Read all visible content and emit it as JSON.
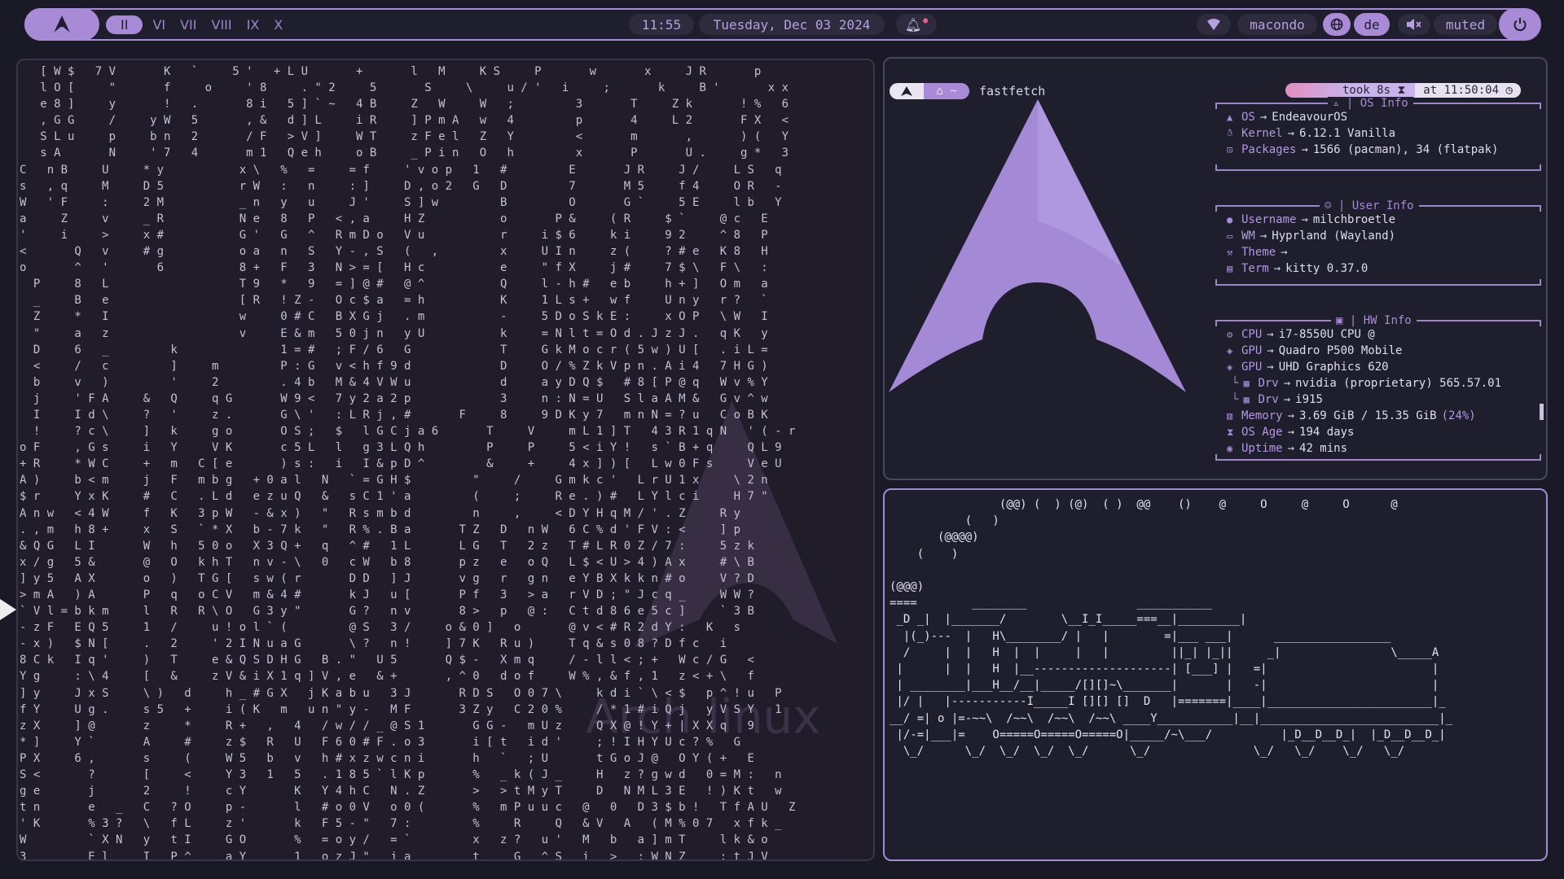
{
  "bar": {
    "workspaces": [
      {
        "label": "II",
        "active": true
      },
      {
        "label": "VI",
        "active": false
      },
      {
        "label": "VII",
        "active": false
      },
      {
        "label": "VIII",
        "active": false
      },
      {
        "label": "IX",
        "active": false
      },
      {
        "label": "X",
        "active": false
      }
    ],
    "time": "11:55",
    "date": "Tuesday, Dec 03 2024",
    "hostname": "macondo",
    "language": "de",
    "volume_status": "muted",
    "icons": [
      "arch-logo-icon",
      "bell-icon",
      "wifi-icon",
      "globe-icon",
      "speaker-muted-icon",
      "power-icon"
    ]
  },
  "matrix": {
    "watermark": "Arch linux",
    "lines": [
      "   [ W $   7 V       K   `     5 '   + L U       +       l   M     K S     P       w       x     J R       p",
      "   l O [     \"       f     o     ' 8     . \" 2     5       S     \\     u / '   i     ;       k     B '       x x",
      "   e 8 ]     y       !   .       8 i   5 ] ` ~   4 B     Z   W     W   ;         3       T     Z k       ! %   6",
      "   , G G     /     y W   5       , &   d ] L     i R     ] P m A   w   4         p       4     L 2       F X   <",
      "   S L u     p     b n   2       / F   > V ]     W T     z F e l   Z   Y         <       m       ,       ) (   Y",
      "   s A       N     ' 7   4       m 1   Q e h     o B     _ P i n   O   h         x       P       U .     g *   3",
      "C   n B     U     * y           x \\   %   =     = f     ' v o p   1   #         E       J R     J /     L S   q",
      "s   , q     M     D 5           r W   :   n     : ]     D , o 2   G   D         7       M 5     f 4     O R   -",
      "W   ' F     :     2 M           _ n   y   u     J '     S ] w         B         O       G `     5 E     l b   Y",
      "a     Z     v     _ R           N e   8   P   < , a     H Z           o       P &     ( R     $ `     @ c   E",
      "'     i     >     x #           G '   G   ^   R m D o   V u           r     i $ 6     k i     9 2     ^ 8   P",
      "<       Q   v     # g           o a   n   S   Y - , S   (   ,         x     U I n     z (     ? # e   K 8   H",
      "o       ^   '       6           8 +   F   3   N > = [   H c           e     \" f X     j #     7 $ \\   F \\   :",
      "  P     8   L                   T 9   *   9   = ] @ #   @ ^           Q     l - h #   e b     h + ]   O m   a",
      "  _     B   e                   [ R   ! Z -   O c $ a   = h           K     1 L s +   w f     U n y   r ?   `",
      "  Z     *   I                   w     0 # C   B X G j   . m           -     5 D o S k E :     x O P   \\ W   I",
      "  \"     a   z                   v     E & m   5 0 j n   y U           k     = N l t = O d . J z J .   q K   y",
      "  D     6   _         k               1 = #   ; F / 6   G             T     G k M o c r ( 5 w ) U [   . i L =",
      "  <     /   c         ]     m         P : G   v < h f 9 d             D     O / % Z k V p n . A i 4   7 H G )",
      "  b     v   )         '     2         . 4 b   M & 4 V W u             d     a y D Q $   # 8 [ P @ q   W v % Y",
      "  j     ' F A     &   Q     q G       W 9 <   7 y 2 a 2 p             3     n : N = U   S l a A M &   G v ^ w",
      "  I     I d \\     ?   '     z .       G \\ '   : L R j , #       F     8     9 D K y 7   m n N = ? u   C o B K",
      "  !     ? c \\     ]   k     g o       O S ;   $   l G C j a 6       T     V     m L 1 ] T   4 3 R 1 q N   ' ( - r",
      "o F     , G s     i   Y     V K       c 5 L   l   g 3 L Q h         P     P     5 < i Y !   s ` B + q     Q L 9",
      "+ R     * W C     +   m   C [ e       ) s :   i   I & p D ^         &     +     4 x ] ) [   L w 0 F s     V e U",
      "A )     b < m     j   F   m b g   + 0 a l   N   ` = G H $         \"     /     G m k c '   L r U 1 x     \\ 2 n",
      "$ r     Y x K     #   C   . L d   e z u Q   &   s C 1 ' a         (     ;     R e . ) #   L Y l c i     H 7 \"",
      "A n w   < 4 W     f   K   3 p W   - & x )   \"   R s m b d         n     ,     < D Y H q M / ' . Z     R y",
      ". , m   h 8 +     x   S   ` * X   b - 7 k   \"   R % . B a       T Z   D   n W   6 C % d ' F V : <     ] p",
      "& Q G   L I       W   h   5 0 o   X 3 Q +   q   ^ #   1 L       L G   T   2 z   T # L R 0 Z / 7 :     5 z k",
      "x / g   5 &       @   O   k h T   n v - \\   0   c W   b 8       p z   e   o Q   L $ < U > 4 ) A x     # \\ B",
      "] y 5   A X       o   )   T G [   s w ( r       D D   ] J       v g   r   g n   e Y B X k k n # o     V ? D",
      "> m A   ) A       P   q   o C V   m & 4 #       k J   u [       P f   3   > a   r V D ; \" J c q _     W W ?",
      "` V l = b k m     l   R   R \\ O   G 3 y \"       G ?   n v       8 >   p   @ :   C t d 8 6 e 5 c ]     ` 3 B",
      "- z F   E Q 5     1   /     u ! o l ` (         @ S   3 /     o & 0 ]   o       @ v < # R 2 d Y :   K   s",
      "- x )   $ N [     .   2     ' 2 I N u a G       \\ ?   n !     ] 7 K   R u )     T q & s 0 8 ? D f c   i",
      "8 C k   I q '     )   T     e & Q S D H G   B . \"   U 5       Q $ -   X m q     / - l l < ; +   W c / G   <",
      "Y g     : \\ 4     [   &     z V & i X 1 q ] V , e   & +       , ^ 0   d o f     W % , & f , 1   z < + \\   f",
      "] y     J x S     \\ )   d     h _ # G X   j K a b u   3 J       R D S   O 0 7 \\     k d i ` \\ < $   p ^ ! u   P",
      "f Y     U g .     s 5   +     i ( K   m   u n \" y -   M F       3 Z y   C 2 0 %     / * 1 # i Q j   y V S Y   1",
      "z X     ] @       z     *     R +   ,   4   / w / / _ @ S 1       G G -   m U z     Q X @ ! Y + | X X q   9",
      "* ]     Y `       A     #     z $   R   U   F 6 0 # F . o 3       i [ t   i d '     ; ! I H Y U c ? %   G",
      "P X     6 ,       s     (     W 5   b   v   h # x z w c n i       h   `   ; U       t G o J @   O Y ( +   E",
      "S <       ?       [     <     Y 3   1   5   . 1 8 5 ` l K p       %   _ k ( J _     H   z ? g w d   0 = M :   n",
      "g e       j       2     !     c Y       K   Y 4 h C   N . Z       >   > t M y T     D   N M L 3 E   ! ) K t   w",
      "t n       e   _   C   ? O     p -       l   # o 0 V   o 0 (       %   m P u u c   @   0   D 3 $ b !   T f A U   Z",
      "' K       % 3 ?   \\   f L     z '       k   F 5 - \"   7 :         %     R     Q   & V   A   ( M % 0 7   x f k _",
      "W         ` X N   y   t I     G O       %   = o y /   = `         x   z ?   u '   M   b   a ] m T     l k & o",
      "3         E l     I   P ^     a Y       1   o z J \"   j a         t     G   ^ S   i   >   : W N Z     : t J V"
    ]
  },
  "fetch": {
    "prompt_path": "~",
    "command": "fastfetch",
    "took": "took 8s",
    "at": "at 11:50:04",
    "os_title": "| OS Info",
    "user_title": "| User Info",
    "hw_title": "| HW Info",
    "os_rows": [
      {
        "icon": "arch-icon",
        "key": "OS",
        "value": "EndeavourOS"
      },
      {
        "icon": "linux-icon",
        "key": "Kernel",
        "value": "6.12.1 Vanilla"
      },
      {
        "icon": "package-icon",
        "key": "Packages",
        "value": "1566 (pacman), 34 (flatpak)"
      }
    ],
    "user_rows": [
      {
        "icon": "user-icon",
        "key": "Username",
        "value": "milchbroetle"
      },
      {
        "icon": "window-icon",
        "key": "WM",
        "value": "Hyprland (Wayland)"
      },
      {
        "icon": "brush-icon",
        "key": "Theme",
        "value": ""
      },
      {
        "icon": "terminal-icon",
        "key": "Term",
        "value": "kitty 0.37.0"
      }
    ],
    "hw_rows": [
      {
        "icon": "cpu-icon",
        "key": "CPU",
        "value": "i7-8550U CPU @",
        "sub": false
      },
      {
        "icon": "gpu-icon",
        "key": "GPU",
        "value": "Quadro P500 Mobile",
        "sub": false
      },
      {
        "icon": "gpu-icon",
        "key": "GPU",
        "value": "UHD Graphics 620",
        "sub": false
      },
      {
        "icon": "driver-icon",
        "key": "Drv",
        "value": "nvidia (proprietary) 565.57.01",
        "sub": true
      },
      {
        "icon": "driver-icon",
        "key": "Drv",
        "value": "i915",
        "sub": true
      },
      {
        "icon": "memory-icon",
        "key": "Memory",
        "value": "3.69 GiB / 15.35 GiB",
        "pct": "(24%)",
        "sub": false
      },
      {
        "icon": "hourglass-icon",
        "key": "OS Age",
        "value": "194 days",
        "sub": false
      },
      {
        "icon": "uptime-icon",
        "key": "Uptime",
        "value": "42 mins",
        "sub": false
      }
    ]
  },
  "train": {
    "art": "                (@@) (  ) (@)  ( )  @@    ()    @     O     @     O      @\n           (   )\n       (@@@@)\n    (    )\n\n(@@@)\n====        ________                ___________\n _D _|  |_______/        \\__I_I_____===__|_________|\n  |(_)---  |   H\\________/ |   |        =|___ ___|      _________________\n  /     |  |   H  |  |     |   |         ||_| |_||     _|                \\_____A\n |      |  |   H  |__--------------------| [___] |   =|                        |\n | ________|___H__/__|_____/[][]~\\_______|       |   -|                        |\n |/ |   |-----------I_____I [][] []  D   |=======|____|________________________|_\n__/ =| o |=-~~\\  /~~\\  /~~\\  /~~\\ ____Y___________|__|__________________________|_\n |/-=|___|=    O=====O=====O=====O|_____/~\\___/          |_D__D__D_|  |_D__D__D_|\n  \\_/      \\_/  \\_/  \\_/  \\_/      \\_/               \\_/   \\_/    \\_/   \\_/"
  }
}
